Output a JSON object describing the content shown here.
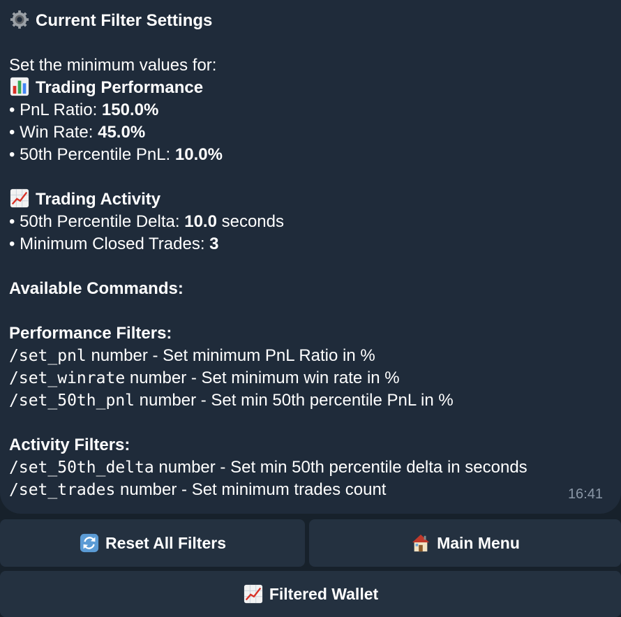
{
  "message": {
    "title": "Current Filter Settings",
    "intro": "Set the minimum values for:",
    "performance_heading": "Trading Performance",
    "performance": [
      {
        "label": "PnL Ratio: ",
        "value": "150.0%"
      },
      {
        "label": "Win Rate: ",
        "value": "45.0%"
      },
      {
        "label": "50th Percentile PnL: ",
        "value": "10.0%"
      }
    ],
    "activity_heading": "Trading Activity",
    "activity": [
      {
        "label": "50th Percentile Delta: ",
        "value": "10.0",
        "suffix": " seconds"
      },
      {
        "label": "Minimum Closed Trades: ",
        "value": "3",
        "suffix": ""
      }
    ],
    "commands_heading": "Available Commands:",
    "perf_filters_heading": "Performance Filters:",
    "perf_commands": [
      {
        "cmd": "/set_pnl",
        "desc": " number - Set minimum PnL Ratio in %"
      },
      {
        "cmd": "/set_winrate",
        "desc": " number - Set minimum win rate in %"
      },
      {
        "cmd": "/set_50th_pnl",
        "desc": " number - Set min 50th percentile PnL in %"
      }
    ],
    "act_filters_heading": "Activity Filters:",
    "act_commands": [
      {
        "cmd": "/set_50th_delta",
        "desc": " number - Set min 50th percentile delta in seconds"
      },
      {
        "cmd": "/set_trades",
        "desc": " number - Set minimum trades count"
      }
    ],
    "time": "16:41"
  },
  "buttons": {
    "reset": "Reset All Filters",
    "main_menu": "Main Menu",
    "filtered_wallet": "Filtered Wallet"
  },
  "icons": {
    "title": "gear-icon",
    "performance": "bar-chart-icon",
    "activity": "chart-increasing-icon",
    "reset": "refresh-icon",
    "main_menu": "house-icon",
    "filtered_wallet": "chart-increasing-icon"
  }
}
